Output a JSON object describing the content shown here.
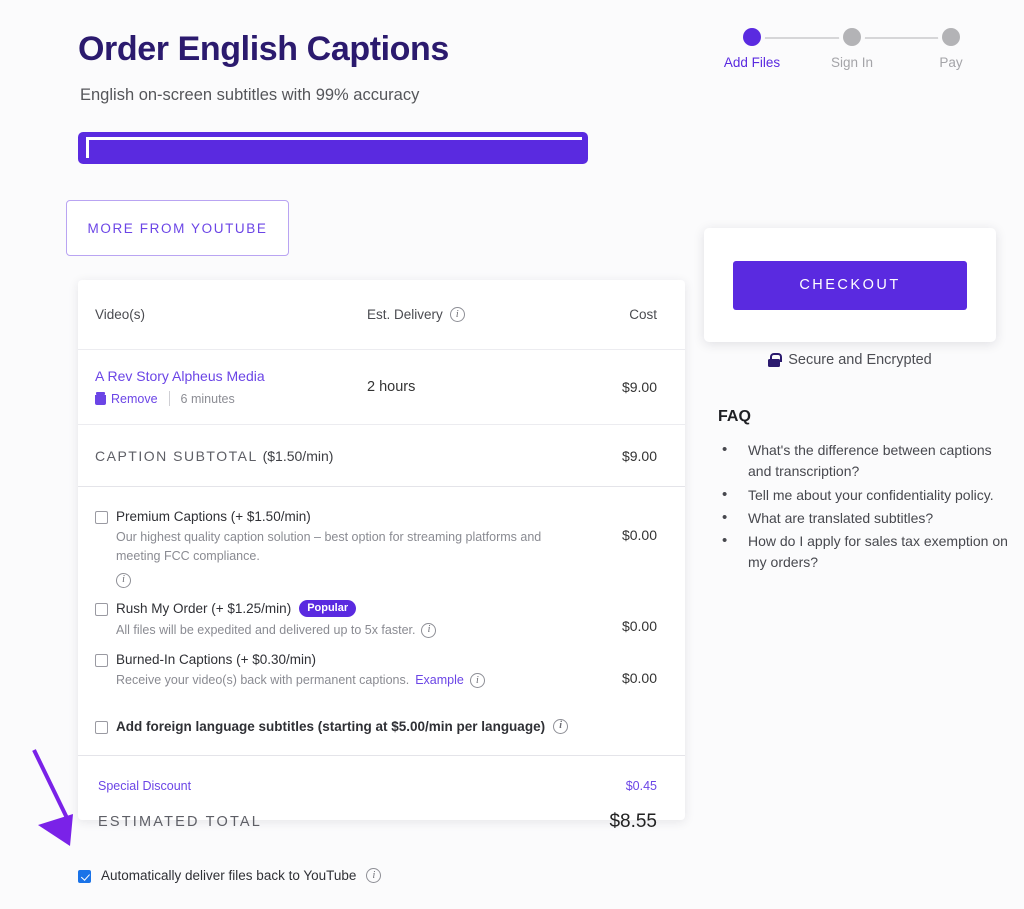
{
  "header": {
    "title": "Order English Captions",
    "subtitle": "English on-screen subtitles with 99% accuracy"
  },
  "stepper": {
    "steps": [
      {
        "label": "Add Files",
        "state": "active"
      },
      {
        "label": "Sign In",
        "state": "inactive"
      },
      {
        "label": "Pay",
        "state": "inactive"
      }
    ]
  },
  "buttons": {
    "more_from_youtube": "MORE FROM YOUTUBE",
    "checkout": "CHECKOUT"
  },
  "secure": {
    "label": "Secure and Encrypted",
    "icon": "lock-icon"
  },
  "order_table": {
    "headers": {
      "video": "Video(s)",
      "delivery": "Est. Delivery",
      "cost": "Cost"
    },
    "rows": [
      {
        "name": "A Rev Story Alpheus Media",
        "remove": "Remove",
        "duration": "6 minutes",
        "delivery": "2 hours",
        "cost": "$9.00"
      }
    ],
    "subtotal": {
      "label": "CAPTION SUBTOTAL",
      "rate": "($1.50/min)",
      "value": "$9.00"
    }
  },
  "options": [
    {
      "title": "Premium Captions (+ $1.50/min)",
      "description": "Our highest quality caption solution – best option for streaming platforms and meeting FCC compliance.",
      "price": "$0.00",
      "checked": false,
      "bold": false,
      "badge": null,
      "link": null
    },
    {
      "title": "Rush My Order (+ $1.25/min)",
      "description": "All files will be expedited and delivered up to 5x faster.",
      "price": "$0.00",
      "checked": false,
      "bold": false,
      "badge": "Popular",
      "link": null
    },
    {
      "title": "Burned-In Captions (+ $0.30/min)",
      "description": "Receive your video(s) back with permanent captions.",
      "price": "$0.00",
      "checked": false,
      "bold": false,
      "badge": null,
      "link": "Example"
    },
    {
      "title": "Add foreign language subtitles (starting at $5.00/min per language)",
      "description": null,
      "price": "",
      "checked": false,
      "bold": true,
      "badge": null,
      "link": null
    }
  ],
  "totals": {
    "discount_label": "Special Discount",
    "discount_value": "$0.45",
    "estimated_label": "ESTIMATED TOTAL",
    "estimated_value": "$8.55"
  },
  "faq": {
    "title": "FAQ",
    "items": [
      "What's the difference between captions and transcription?",
      "Tell me about your confidentiality policy.",
      "What are translated subtitles?",
      "How do I apply for sales tax exemption on my orders?"
    ]
  },
  "bottom_option": {
    "label": "Automatically deliver files back to YouTube",
    "checked": true
  },
  "colors": {
    "brand_purple": "#5a2ae0",
    "link_purple": "#6b45e6",
    "title_navy": "#2b1a6e",
    "checkbox_blue": "#1a73e8",
    "page_background": "#fbfbfc"
  }
}
